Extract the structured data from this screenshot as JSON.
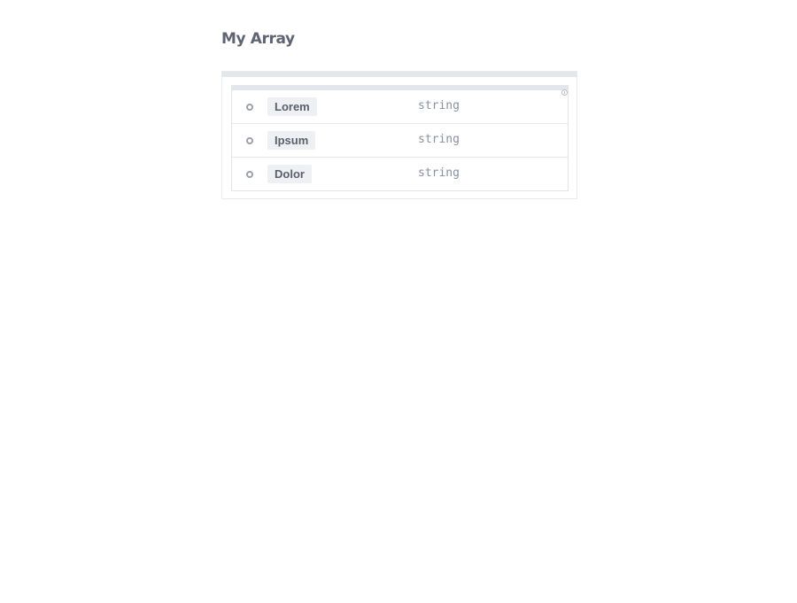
{
  "title": "My Array",
  "items": [
    {
      "name": "Lorem",
      "type": "string"
    },
    {
      "name": "Ipsum",
      "type": "string"
    },
    {
      "name": "Dolor",
      "type": "string"
    }
  ],
  "icons": {
    "corner": "info-icon",
    "bullet": "bullet-circle-icon"
  },
  "colors": {
    "title": "#5f6472",
    "chip_bg": "#eef0f3",
    "type_text": "#8a90a0",
    "header_bar": "#e3e7ec"
  }
}
